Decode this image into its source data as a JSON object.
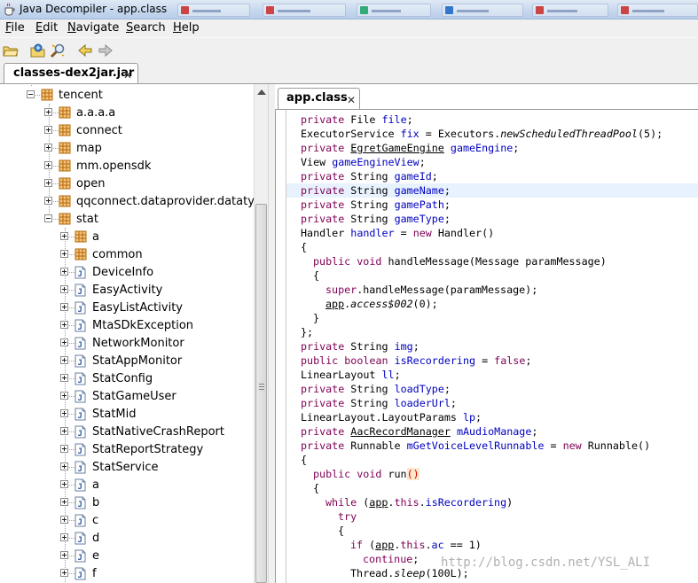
{
  "window": {
    "title": "Java Decompiler - app.class"
  },
  "menu": [
    {
      "label": "File",
      "mnemonic": "F",
      "rest": "ile"
    },
    {
      "label": "Edit",
      "mnemonic": "E",
      "rest": "dit"
    },
    {
      "label": "Navigate",
      "mnemonic": "N",
      "rest": "avigate"
    },
    {
      "label": "Search",
      "mnemonic": "S",
      "rest": "earch"
    },
    {
      "label": "Help",
      "mnemonic": "H",
      "rest": "elp"
    }
  ],
  "toolbar": {
    "icons": [
      "open-file-icon",
      "open-type-icon",
      "search-icon",
      "back-icon",
      "forward-icon"
    ]
  },
  "outer_tab": {
    "label": "classes-dex2jar.jar"
  },
  "inner_tab": {
    "label": "app.class"
  },
  "tree": {
    "nodes": [
      {
        "label": "tencent",
        "type": "package",
        "depth": 0,
        "expanded": true
      },
      {
        "label": "a.a.a.a",
        "type": "package",
        "depth": 1,
        "expanded": false
      },
      {
        "label": "connect",
        "type": "package",
        "depth": 1,
        "expanded": false
      },
      {
        "label": "map",
        "type": "package",
        "depth": 1,
        "expanded": false
      },
      {
        "label": "mm.opensdk",
        "type": "package",
        "depth": 1,
        "expanded": false
      },
      {
        "label": "open",
        "type": "package",
        "depth": 1,
        "expanded": false
      },
      {
        "label": "qqconnect.dataprovider.datatype",
        "type": "package",
        "depth": 1,
        "expanded": false
      },
      {
        "label": "stat",
        "type": "package",
        "depth": 1,
        "expanded": true
      },
      {
        "label": "a",
        "type": "package",
        "depth": 2,
        "expanded": false
      },
      {
        "label": "common",
        "type": "package",
        "depth": 2,
        "expanded": false
      },
      {
        "label": "DeviceInfo",
        "type": "class",
        "depth": 2,
        "expanded": false
      },
      {
        "label": "EasyActivity",
        "type": "class",
        "depth": 2,
        "expanded": false
      },
      {
        "label": "EasyListActivity",
        "type": "class",
        "depth": 2,
        "expanded": false
      },
      {
        "label": "MtaSDkException",
        "type": "class",
        "depth": 2,
        "expanded": false
      },
      {
        "label": "NetworkMonitor",
        "type": "class",
        "depth": 2,
        "expanded": false
      },
      {
        "label": "StatAppMonitor",
        "type": "class",
        "depth": 2,
        "expanded": false
      },
      {
        "label": "StatConfig",
        "type": "class",
        "depth": 2,
        "expanded": false
      },
      {
        "label": "StatGameUser",
        "type": "class",
        "depth": 2,
        "expanded": false
      },
      {
        "label": "StatMid",
        "type": "class",
        "depth": 2,
        "expanded": false
      },
      {
        "label": "StatNativeCrashReport",
        "type": "class",
        "depth": 2,
        "expanded": false
      },
      {
        "label": "StatReportStrategy",
        "type": "class",
        "depth": 2,
        "expanded": false
      },
      {
        "label": "StatService",
        "type": "class",
        "depth": 2,
        "expanded": false
      },
      {
        "label": "a",
        "type": "class",
        "depth": 2,
        "expanded": false
      },
      {
        "label": "b",
        "type": "class",
        "depth": 2,
        "expanded": false
      },
      {
        "label": "c",
        "type": "class",
        "depth": 2,
        "expanded": false
      },
      {
        "label": "d",
        "type": "class",
        "depth": 2,
        "expanded": false
      },
      {
        "label": "e",
        "type": "class",
        "depth": 2,
        "expanded": false
      },
      {
        "label": "f",
        "type": "class",
        "depth": 2,
        "expanded": false
      }
    ]
  },
  "code": {
    "lines": [
      {
        "indent": 0,
        "tokens": [
          [
            "kw",
            "private "
          ],
          [
            "",
            "File "
          ],
          [
            "fd",
            "file"
          ],
          [
            "",
            ";"
          ]
        ]
      },
      {
        "indent": 0,
        "tokens": [
          [
            "",
            "ExecutorService "
          ],
          [
            "fd",
            "fix"
          ],
          [
            "",
            " = Executors."
          ],
          [
            "it",
            "newScheduledThreadPool"
          ],
          [
            "",
            "(5);"
          ]
        ]
      },
      {
        "indent": 0,
        "tokens": [
          [
            "kw",
            "private "
          ],
          [
            "lk",
            "EgretGameEngine"
          ],
          [
            "",
            " "
          ],
          [
            "fd",
            "gameEngine"
          ],
          [
            "",
            ";"
          ]
        ]
      },
      {
        "indent": 0,
        "tokens": [
          [
            "",
            "View "
          ],
          [
            "fd",
            "gameEngineView"
          ],
          [
            "",
            ";"
          ]
        ]
      },
      {
        "indent": 0,
        "tokens": [
          [
            "kw",
            "private "
          ],
          [
            "",
            "String "
          ],
          [
            "fd",
            "gameId"
          ],
          [
            "",
            ";"
          ]
        ]
      },
      {
        "indent": 0,
        "hl": true,
        "tokens": [
          [
            "kw",
            "private "
          ],
          [
            "",
            "String "
          ],
          [
            "fd",
            "gameName"
          ],
          [
            "",
            ";"
          ]
        ]
      },
      {
        "indent": 0,
        "tokens": [
          [
            "kw",
            "private "
          ],
          [
            "",
            "String "
          ],
          [
            "fd",
            "gamePath"
          ],
          [
            "",
            ";"
          ]
        ]
      },
      {
        "indent": 0,
        "tokens": [
          [
            "kw",
            "private "
          ],
          [
            "",
            "String "
          ],
          [
            "fd",
            "gameType"
          ],
          [
            "",
            ";"
          ]
        ]
      },
      {
        "indent": 0,
        "tokens": [
          [
            "",
            "Handler "
          ],
          [
            "fd",
            "handler"
          ],
          [
            "",
            " = "
          ],
          [
            "kw",
            "new "
          ],
          [
            "",
            "Handler()"
          ]
        ]
      },
      {
        "indent": 0,
        "tokens": [
          [
            "",
            "{"
          ]
        ]
      },
      {
        "indent": 1,
        "tokens": [
          [
            "kw",
            "public void "
          ],
          [
            "",
            "handleMessage(Message paramMessage)"
          ]
        ]
      },
      {
        "indent": 1,
        "tokens": [
          [
            "",
            "{"
          ]
        ]
      },
      {
        "indent": 2,
        "tokens": [
          [
            "kw",
            "super"
          ],
          [
            "",
            ".handleMessage(paramMessage);"
          ]
        ]
      },
      {
        "indent": 2,
        "tokens": [
          [
            "lk",
            "app"
          ],
          [
            "",
            "."
          ],
          [
            "it",
            "access$002"
          ],
          [
            "",
            "(0);"
          ]
        ]
      },
      {
        "indent": 1,
        "tokens": [
          [
            "",
            "}"
          ]
        ]
      },
      {
        "indent": 0,
        "tokens": [
          [
            "",
            "};"
          ]
        ]
      },
      {
        "indent": 0,
        "tokens": [
          [
            "kw",
            "private "
          ],
          [
            "",
            "String "
          ],
          [
            "fd",
            "img"
          ],
          [
            "",
            ";"
          ]
        ]
      },
      {
        "indent": 0,
        "tokens": [
          [
            "kw",
            "public boolean "
          ],
          [
            "fd",
            "isRecordering"
          ],
          [
            "",
            " = "
          ],
          [
            "kw",
            "false"
          ],
          [
            "",
            ";"
          ]
        ]
      },
      {
        "indent": 0,
        "tokens": [
          [
            "",
            "LinearLayout "
          ],
          [
            "fd",
            "ll"
          ],
          [
            "",
            ";"
          ]
        ]
      },
      {
        "indent": 0,
        "tokens": [
          [
            "kw",
            "private "
          ],
          [
            "",
            "String "
          ],
          [
            "fd",
            "loadType"
          ],
          [
            "",
            ";"
          ]
        ]
      },
      {
        "indent": 0,
        "tokens": [
          [
            "kw",
            "private "
          ],
          [
            "",
            "String "
          ],
          [
            "fd",
            "loaderUrl"
          ],
          [
            "",
            ";"
          ]
        ]
      },
      {
        "indent": 0,
        "tokens": [
          [
            "",
            "LinearLayout.LayoutParams "
          ],
          [
            "fd",
            "lp"
          ],
          [
            "",
            ";"
          ]
        ]
      },
      {
        "indent": 0,
        "tokens": [
          [
            "kw",
            "private "
          ],
          [
            "lk",
            "AacRecordManager"
          ],
          [
            "",
            " "
          ],
          [
            "fd",
            "mAudioManage"
          ],
          [
            "",
            ";"
          ]
        ]
      },
      {
        "indent": 0,
        "tokens": [
          [
            "kw",
            "private "
          ],
          [
            "",
            "Runnable "
          ],
          [
            "fd",
            "mGetVoiceLevelRunnable"
          ],
          [
            "",
            " = "
          ],
          [
            "kw",
            "new "
          ],
          [
            "",
            "Runnable()"
          ]
        ]
      },
      {
        "indent": 0,
        "tokens": [
          [
            "",
            "{"
          ]
        ]
      },
      {
        "indent": 1,
        "tokens": [
          [
            "kw",
            "public void "
          ],
          [
            "",
            "run"
          ],
          [
            "mark",
            "()"
          ]
        ]
      },
      {
        "indent": 1,
        "tokens": [
          [
            "",
            "{"
          ]
        ]
      },
      {
        "indent": 2,
        "tokens": [
          [
            "kw",
            "while "
          ],
          [
            "",
            "("
          ],
          [
            "lk",
            "app"
          ],
          [
            "",
            "."
          ],
          [
            "kw",
            "this"
          ],
          [
            "",
            "."
          ],
          [
            "fd",
            "isRecordering"
          ],
          [
            "",
            ")"
          ]
        ]
      },
      {
        "indent": 3,
        "tokens": [
          [
            "kw",
            "try"
          ]
        ]
      },
      {
        "indent": 3,
        "tokens": [
          [
            "",
            "{"
          ]
        ]
      },
      {
        "indent": 4,
        "tokens": [
          [
            "kw",
            "if "
          ],
          [
            "",
            "("
          ],
          [
            "lk",
            "app"
          ],
          [
            "",
            "."
          ],
          [
            "kw",
            "this"
          ],
          [
            "",
            "."
          ],
          [
            "fd",
            "ac"
          ],
          [
            "",
            " == 1)"
          ]
        ]
      },
      {
        "indent": 5,
        "tokens": [
          [
            "kw",
            "continue"
          ],
          [
            "",
            ";"
          ]
        ]
      },
      {
        "indent": 4,
        "tokens": [
          [
            "",
            "Thread."
          ],
          [
            "it",
            "sleep"
          ],
          [
            "",
            "(100L);"
          ]
        ]
      }
    ]
  },
  "watermark": "http://blog.csdn.net/YSL_ALI",
  "colors": {
    "keyword": "#7f0055",
    "field": "#0000c0",
    "package_icon": "#c8700a",
    "class_icon": "#2c5aa0",
    "line_highlight": "#e8f2fe"
  }
}
